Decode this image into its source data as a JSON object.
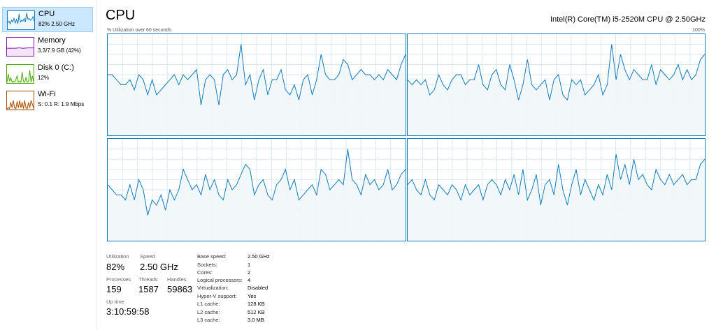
{
  "sidebar": {
    "items": [
      {
        "name": "CPU",
        "detail": "82% 2.50 GHz",
        "color": "#117dbb",
        "fill": "#f1f6fa",
        "trace": [
          0.35,
          0.45,
          0.3,
          0.5,
          0.4,
          0.6,
          0.35,
          0.55,
          0.3,
          0.85,
          0.4,
          0.5,
          0.45,
          0.6,
          0.4,
          0.9,
          0.55,
          0.6,
          0.5,
          0.55,
          0.7,
          0.45
        ],
        "selected": true
      },
      {
        "name": "Memory",
        "detail": "3.3/7.9 GB (42%)",
        "color": "#8b12ae",
        "fill": "#f2e6f6",
        "trace": [
          0.42,
          0.42,
          0.42,
          0.41,
          0.42,
          0.42,
          0.42,
          0.42,
          0.43,
          0.43,
          0.43,
          0.43,
          0.42,
          0.42,
          0.42,
          0.43,
          0.43,
          0.44,
          0.44,
          0.44,
          0.44,
          0.44
        ],
        "selected": false
      },
      {
        "name": "Disk 0 (C:)",
        "detail": "12%",
        "color": "#4da60c",
        "fill": "#effde0",
        "trace": [
          0.05,
          0.5,
          0.1,
          0.3,
          0.05,
          0.1,
          0.05,
          0.2,
          0.4,
          0.05,
          0.1,
          0.05,
          0.6,
          0.1,
          0.05,
          0.3,
          0.05,
          0.1,
          0.7,
          0.05,
          0.4,
          0.1
        ],
        "selected": false
      },
      {
        "name": "Wi-Fi",
        "detail": "S: 0.1  R: 1.9 Mbps",
        "color": "#a74f01",
        "fill": "#fcf3eb",
        "trace": [
          0.05,
          0.1,
          0.05,
          0.4,
          0.1,
          0.5,
          0.1,
          0.05,
          0.45,
          0.1,
          0.5,
          0.1,
          0.4,
          0.05,
          0.5,
          0.1,
          0.05,
          0.4,
          0.1,
          0.5,
          0.3,
          0.1
        ],
        "selected": false
      }
    ]
  },
  "header": {
    "title": "CPU",
    "model": "Intel(R) Core(TM) i5-2520M CPU @ 2.50GHz",
    "graph_caption": "% Utilization over 60 seconds",
    "graph_max": "100%"
  },
  "graph_colors": {
    "line": "#117dbb",
    "fill": "#f1f6fa",
    "grid": "#d9eaf4",
    "border": "#117dbb"
  },
  "cores": [
    {
      "values": [
        60,
        60,
        55,
        50,
        50,
        55,
        45,
        60,
        55,
        40,
        55,
        40,
        45,
        50,
        55,
        60,
        50,
        60,
        55,
        60,
        65,
        30,
        55,
        60,
        55,
        30,
        60,
        65,
        55,
        60,
        90,
        50,
        60,
        35,
        55,
        65,
        40,
        55,
        55,
        65,
        45,
        40,
        50,
        35,
        55,
        60,
        40,
        55,
        80,
        60,
        55,
        55,
        60,
        75,
        70,
        55,
        60,
        65,
        60,
        60,
        55,
        60,
        55,
        65,
        60,
        55,
        70,
        80
      ]
    },
    {
      "values": [
        55,
        50,
        55,
        50,
        55,
        40,
        45,
        60,
        50,
        45,
        55,
        60,
        60,
        50,
        55,
        55,
        70,
        50,
        45,
        60,
        65,
        50,
        45,
        70,
        55,
        35,
        50,
        75,
        50,
        45,
        50,
        55,
        35,
        55,
        60,
        40,
        35,
        55,
        50,
        55,
        40,
        45,
        50,
        60,
        40,
        50,
        90,
        55,
        80,
        65,
        55,
        65,
        60,
        55,
        55,
        70,
        50,
        65,
        60,
        55,
        60,
        70,
        55,
        65,
        55,
        60,
        75,
        80
      ]
    },
    {
      "values": [
        55,
        50,
        45,
        45,
        40,
        55,
        40,
        60,
        50,
        25,
        40,
        35,
        45,
        30,
        50,
        40,
        50,
        70,
        60,
        50,
        55,
        45,
        65,
        50,
        60,
        45,
        40,
        60,
        50,
        55,
        65,
        75,
        70,
        45,
        55,
        60,
        45,
        40,
        55,
        60,
        70,
        50,
        60,
        40,
        45,
        50,
        55,
        45,
        70,
        65,
        50,
        55,
        60,
        55,
        90,
        60,
        55,
        45,
        65,
        55,
        60,
        50,
        55,
        70,
        50,
        55,
        65,
        70
      ]
    },
    {
      "values": [
        55,
        60,
        50,
        45,
        60,
        45,
        40,
        55,
        50,
        45,
        55,
        50,
        40,
        55,
        45,
        50,
        55,
        40,
        55,
        60,
        55,
        45,
        60,
        50,
        65,
        45,
        70,
        40,
        50,
        65,
        35,
        55,
        60,
        45,
        75,
        50,
        35,
        55,
        70,
        45,
        60,
        50,
        40,
        55,
        45,
        65,
        50,
        85,
        60,
        75,
        55,
        80,
        60,
        65,
        55,
        50,
        70,
        60,
        55,
        65,
        55,
        60,
        65,
        55,
        60,
        60,
        75,
        80
      ]
    }
  ],
  "stats": {
    "utilization_label": "Utilization",
    "utilization_value": "82%",
    "speed_label": "Speed",
    "speed_value": "2.50 GHz",
    "processes_label": "Processes",
    "processes_value": "159",
    "threads_label": "Threads",
    "threads_value": "1587",
    "handles_label": "Handles",
    "handles_value": "59863",
    "uptime_label": "Up time",
    "uptime_value": "3:10:59:58"
  },
  "specs": [
    {
      "label": "Base speed:",
      "value": "2.50 GHz"
    },
    {
      "label": "Sockets:",
      "value": "1"
    },
    {
      "label": "Cores:",
      "value": "2"
    },
    {
      "label": "Logical processors:",
      "value": "4"
    },
    {
      "label": "Virtualization:",
      "value": "Disabled"
    },
    {
      "label": "Hyper-V support:",
      "value": "Yes"
    },
    {
      "label": "L1 cache:",
      "value": "128 KB"
    },
    {
      "label": "L2 cache:",
      "value": "512 KB"
    },
    {
      "label": "L3 cache:",
      "value": "3.0 MB"
    }
  ]
}
